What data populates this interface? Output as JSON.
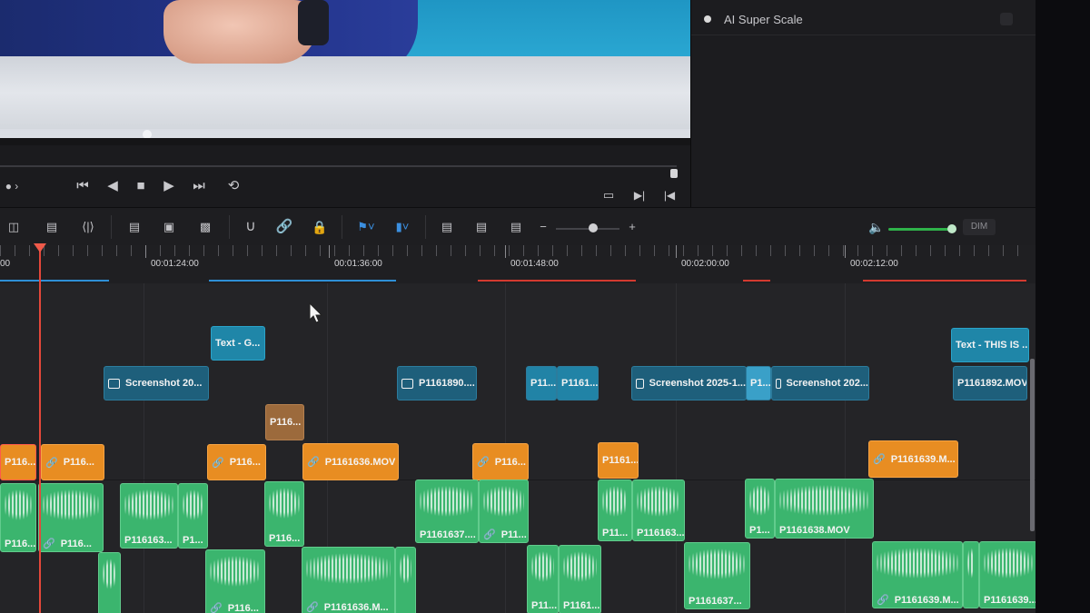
{
  "inspector": {
    "ai_super_scale_label": "AI Super Scale"
  },
  "transport": {
    "icons": [
      "skip-back-icon",
      "step-back-icon",
      "stop-icon",
      "play-icon",
      "skip-forward-icon",
      "loop-icon"
    ]
  },
  "toolbar": {
    "dim_label": "DIM"
  },
  "ruler": {
    "timecodes": [
      "00",
      "00:01:24:00",
      "00:01:36:00",
      "00:01:48:00",
      "00:02:00:00",
      "00:02:12:00"
    ]
  },
  "clips": {
    "text": [
      {
        "label": "Text - G..."
      },
      {
        "label": "Text - THIS IS ..."
      }
    ],
    "v2": [
      {
        "label": "Screenshot 20..."
      },
      {
        "label": "P1161890...."
      },
      {
        "label": "P11..."
      },
      {
        "label": "P1161..."
      },
      {
        "label": "Screenshot 2025-1..."
      },
      {
        "label": "P1..."
      },
      {
        "label": "Screenshot 202..."
      },
      {
        "label": "P1161892.MOV"
      }
    ],
    "brown": [
      {
        "label": "P116..."
      }
    ],
    "v1": [
      {
        "label": "P116..."
      },
      {
        "label": "P116..."
      },
      {
        "label": "P116..."
      },
      {
        "label": "P1161636.MOV"
      },
      {
        "label": "P116..."
      },
      {
        "label": "P1161..."
      },
      {
        "label": "P1161639.M..."
      }
    ],
    "a1": [
      {
        "label": "P116..."
      },
      {
        "label": "P116..."
      },
      {
        "label": "P116163..."
      },
      {
        "label": "P1..."
      },
      {
        "label": "P116..."
      },
      {
        "label": "P1161637...."
      },
      {
        "label": "P11..."
      },
      {
        "label": "P11..."
      },
      {
        "label": "P116163..."
      },
      {
        "label": "P1..."
      },
      {
        "label": "P1161638.MOV"
      }
    ],
    "a2": [
      {
        "label": "P116..."
      },
      {
        "label": "P1161636.M..."
      },
      {
        "label": "P11..."
      },
      {
        "label": "P1161..."
      },
      {
        "label": "P1161637..."
      },
      {
        "label": "P1161639.M..."
      },
      {
        "label": "P1161639..."
      }
    ]
  },
  "colors": {
    "playhead": "#e5473a",
    "audio_clip": "#3bb56e",
    "video_clip": "#e88d22",
    "title_clip": "#1f86a8"
  }
}
